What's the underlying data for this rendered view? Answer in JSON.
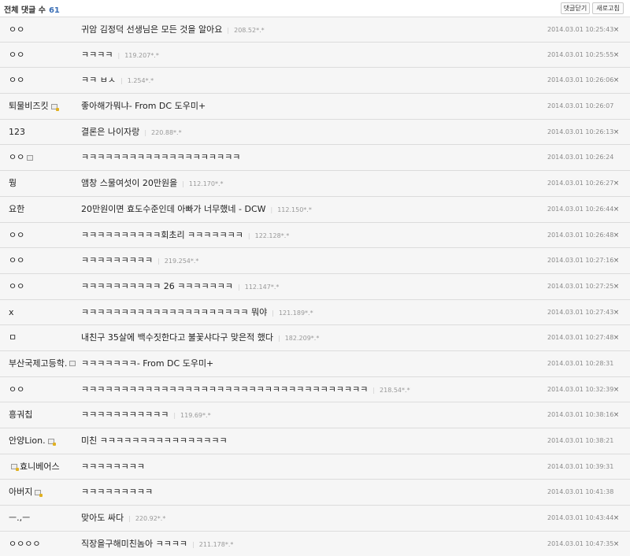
{
  "header": {
    "count_label": "전체 댓글 수",
    "count_value": "61",
    "close_button": "댓글닫기",
    "refresh_button": "새로고침"
  },
  "comments": [
    {
      "nick": "ㅇㅇ",
      "icon": "",
      "text": "귀암 김정덕 선생님은 모든 것을 알아요",
      "ip": "208.52*.*",
      "time": "2014.03.01 10:25:43",
      "deletable": true
    },
    {
      "nick": "ㅇㅇ",
      "icon": "",
      "text": "ㅋㅋㅋㅋ",
      "ip": "119.207*.*",
      "time": "2014.03.01 10:25:55",
      "deletable": true
    },
    {
      "nick": "ㅇㅇ",
      "icon": "",
      "text": "ㅋㅋ ㅂㅅ",
      "ip": "1.254*.*",
      "time": "2014.03.01 10:26:06",
      "deletable": true
    },
    {
      "nick": "퇴물비즈킷",
      "icon": "badge",
      "text": "좋아해가뭐냐- From DC 도우미+",
      "ip": "",
      "time": "2014.03.01 10:26:07",
      "deletable": false
    },
    {
      "nick": "123",
      "icon": "",
      "text": "결론은 나이자랑",
      "ip": "220.88*.*",
      "time": "2014.03.01 10:26:13",
      "deletable": true
    },
    {
      "nick": "ㅇㅇ",
      "icon": "plain",
      "text": "ㅋㅋㅋㅋㅋㅋㅋㅋㅋㅋㅋㅋㅋㅋㅋㅋㅋㅋㅋㅋ",
      "ip": "",
      "time": "2014.03.01 10:26:24",
      "deletable": false
    },
    {
      "nick": "뭥",
      "icon": "",
      "text": "앰창 스물여섯이 20만원을",
      "ip": "112.170*.*",
      "time": "2014.03.01 10:26:27",
      "deletable": true
    },
    {
      "nick": "요한",
      "icon": "",
      "text": "20만원이면 효도수준인데 아빠가 너무했네 - DCW",
      "ip": "112.150*.*",
      "time": "2014.03.01 10:26:44",
      "deletable": true
    },
    {
      "nick": "ㅇㅇ",
      "icon": "",
      "text": "ㅋㅋㅋㅋㅋㅋㅋㅋㅋㅋ회초리 ㅋㅋㅋㅋㅋㅋㅋ",
      "ip": "122.128*.*",
      "time": "2014.03.01 10:26:48",
      "deletable": true
    },
    {
      "nick": "ㅇㅇ",
      "icon": "",
      "text": "ㅋㅋㅋㅋㅋㅋㅋㅋㅋ",
      "ip": "219.254*.*",
      "time": "2014.03.01 10:27:16",
      "deletable": true
    },
    {
      "nick": "ㅇㅇ",
      "icon": "",
      "text": "ㅋㅋㅋㅋㅋㅋㅋㅋㅋㅋ 26 ㅋㅋㅋㅋㅋㅋㅋ",
      "ip": "112.147*.*",
      "time": "2014.03.01 10:27:25",
      "deletable": true
    },
    {
      "nick": "x",
      "icon": "",
      "text": "ㅋㅋㅋㅋㅋㅋㅋㅋㅋㅋㅋㅋㅋㅋㅋㅋㅋㅋㅋㅋㅋ 뭐야",
      "ip": "121.189*.*",
      "time": "2014.03.01 10:27:43",
      "deletable": true
    },
    {
      "nick": "ㅁ",
      "icon": "",
      "text": "내친구 35살에 백수짓한다고 불꽃샤다구 맞은적 했다",
      "ip": "182.209*.*",
      "time": "2014.03.01 10:27:48",
      "deletable": true
    },
    {
      "nick": "부산국제고등학.",
      "icon": "plain",
      "text": "ㅋㅋㅋㅋㅋㅋㅋ- From DC 도우미+",
      "ip": "",
      "time": "2014.03.01 10:28:31",
      "deletable": false
    },
    {
      "nick": "ㅇㅇ",
      "icon": "",
      "text": "ㅋㅋㅋㅋㅋㅋㅋㅋㅋㅋㅋㅋㅋㅋㅋㅋㅋㅋㅋㅋㅋㅋㅋㅋㅋㅋㅋㅋㅋㅋㅋㅋㅋㅋㅋㅋ",
      "ip": "218.54*.*",
      "time": "2014.03.01 10:32:39",
      "deletable": true
    },
    {
      "nick": "흥궈칩",
      "icon": "",
      "text": "ㅋㅋㅋㅋㅋㅋㅋㅋㅋㅋㅋ",
      "ip": "119.69*.*",
      "time": "2014.03.01 10:38:16",
      "deletable": true
    },
    {
      "nick": "안양Lion.",
      "icon": "badge",
      "text": "미친 ㅋㅋㅋㅋㅋㅋㅋㅋㅋㅋㅋㅋㅋㅋㅋㅋ",
      "ip": "",
      "time": "2014.03.01 10:38:21",
      "deletable": false
    },
    {
      "nick": "효니베어스",
      "icon": "badge-left",
      "text": "ㅋㅋㅋㅋㅋㅋㅋㅋ",
      "ip": "",
      "time": "2014.03.01 10:39:31",
      "deletable": false
    },
    {
      "nick": "아버지",
      "icon": "badge",
      "text": "ㅋㅋㅋㅋㅋㅋㅋㅋㅋ",
      "ip": "",
      "time": "2014.03.01 10:41:38",
      "deletable": false
    },
    {
      "nick": "ㅡ.,ㅡ",
      "icon": "",
      "text": "맞아도 싸다",
      "ip": "220.92*.*",
      "time": "2014.03.01 10:43:44",
      "deletable": true
    },
    {
      "nick": "ㅇㅇㅇㅇ",
      "icon": "",
      "text": "직장을구해미친놈아 ㅋㅋㅋㅋ",
      "ip": "211.178*.*",
      "time": "2014.03.01 10:47:35",
      "deletable": true
    }
  ]
}
